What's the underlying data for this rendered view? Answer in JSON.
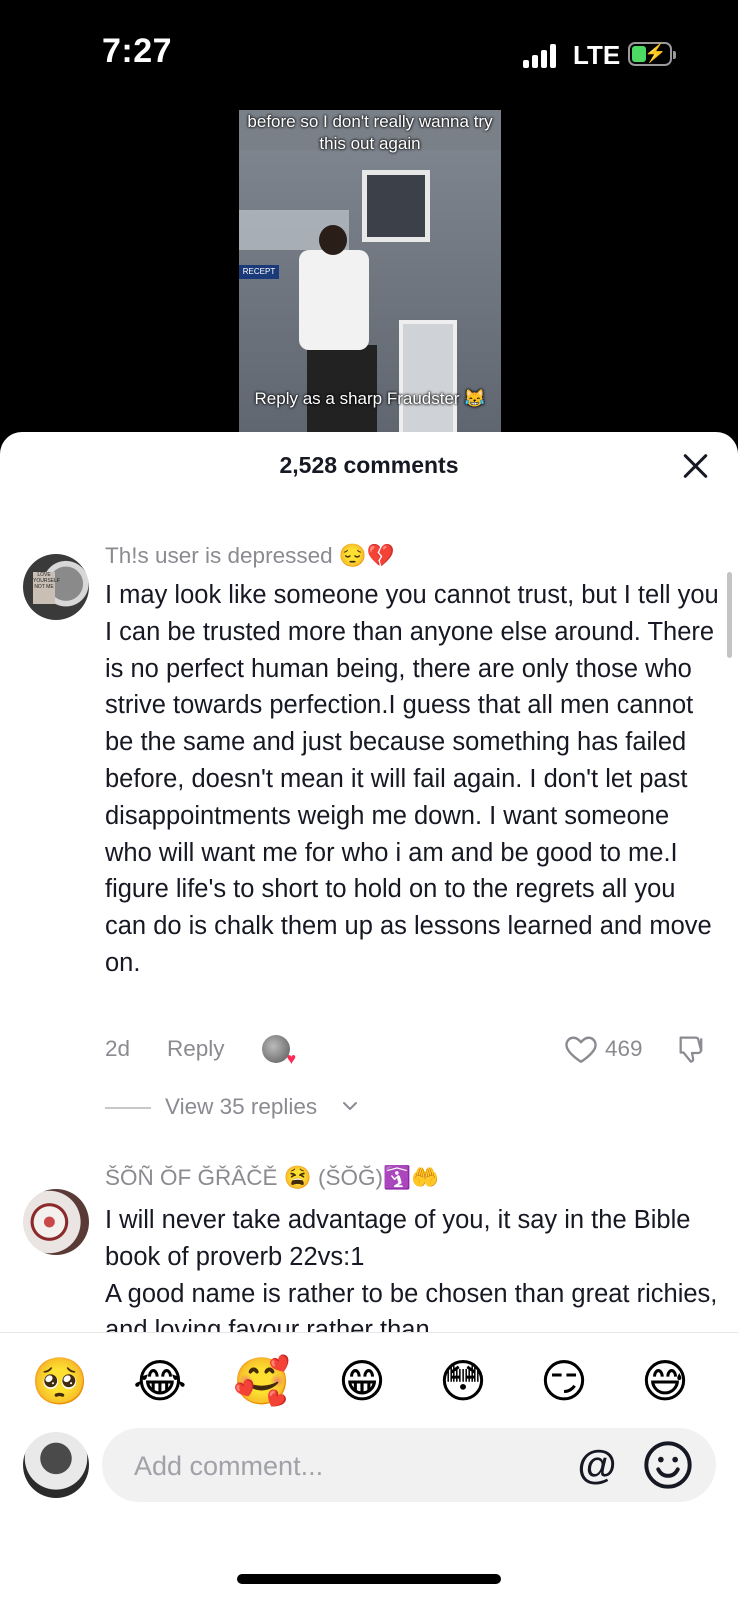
{
  "status_bar": {
    "time": "7:27",
    "network": "LTE"
  },
  "video": {
    "caption_top": "before so I don't really wanna try this out again",
    "caption_bottom": "Reply as a sharp Fraudster 😹",
    "sign_text": "RECEPT"
  },
  "comments_header": {
    "title": "2,528 comments"
  },
  "comments": [
    {
      "username": "Th!s user is depressed 😔💔",
      "avatar_text": "LOVE YOURSELF NOT ME",
      "text": "I may look like someone you cannot trust, but I tell you I can be trusted more than anyone else around. There is no perfect human being, there are only those who strive towards perfection.I guess that all men cannot be the same and just because something has failed before, doesn't mean it will fail again. I don't let past disappointments weigh me down. I want someone who will want me for who i am and be good to me.I figure life's to short to hold on to the regrets all you can do is chalk them up as lessons learned and move on.",
      "time": "2d",
      "reply_label": "Reply",
      "likes": "469",
      "view_replies": "View 35 replies"
    },
    {
      "username": "ŠÕÑ ŎF ĞŘÂČĚ 😫 (ŠŎĞ)🛐🤲",
      "text": "I will never take advantage of you, it say in the Bible book of proverb 22vs:1\nA good name is rather to be chosen than great richies, and loving favour rather than"
    }
  ],
  "emoji_bar": [
    "🥺",
    "😂",
    "🥰",
    "😁",
    "😳",
    "😏",
    "😅"
  ],
  "composer": {
    "placeholder": "Add comment...",
    "at_symbol": "@"
  },
  "colors": {
    "accent_like": "#fe2c55",
    "secondary_text": "#8a8b91",
    "primary_text": "#161823"
  }
}
